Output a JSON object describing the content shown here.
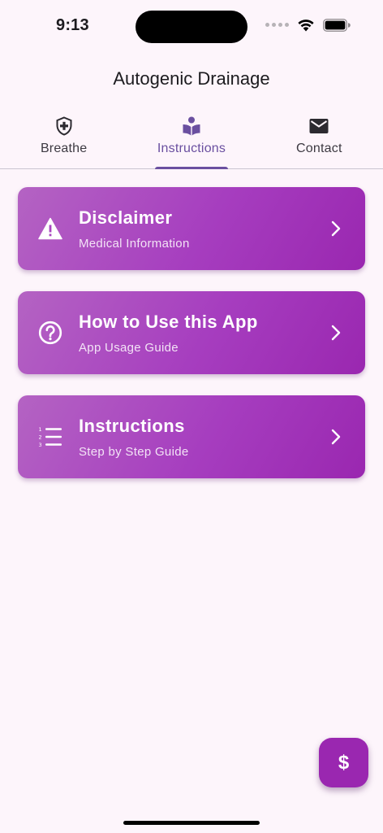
{
  "status_bar": {
    "time": "9:13"
  },
  "app": {
    "title": "Autogenic Drainage"
  },
  "tabs": [
    {
      "label": "Breathe",
      "icon": "shield-plus-icon",
      "active": false
    },
    {
      "label": "Instructions",
      "icon": "book-reader-icon",
      "active": true
    },
    {
      "label": "Contact",
      "icon": "mail-icon",
      "active": false
    }
  ],
  "cards": [
    {
      "title": "Disclaimer",
      "subtitle": "Medical Information",
      "icon": "warning-icon"
    },
    {
      "title": "How to Use this App",
      "subtitle": "App Usage Guide",
      "icon": "help-circle-icon"
    },
    {
      "title": "Instructions",
      "subtitle": "Step by Step Guide",
      "icon": "numbered-list-icon"
    }
  ],
  "fab": {
    "label": "$",
    "icon": "dollar-icon"
  },
  "colors": {
    "background": "#fdf5fb",
    "accent": "#6a4fa0",
    "card_gradient_start": "#b463c3",
    "card_gradient_end": "#9a27b0",
    "fab": "#9a27b0"
  }
}
